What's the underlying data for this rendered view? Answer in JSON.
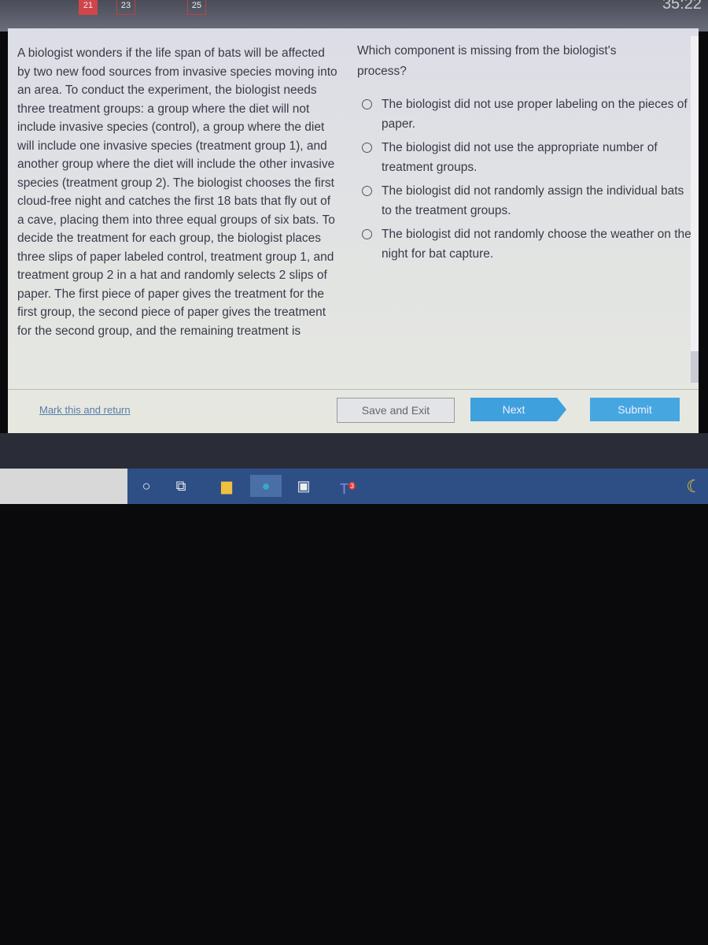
{
  "topbar": {
    "question_numbers": [
      "21",
      "23",
      "25"
    ],
    "timer": "35:22"
  },
  "passage": "A biologist wonders if the life span of bats will be affected by two new food sources from invasive species moving into an area. To conduct the experiment, the biologist needs three treatment groups: a group where the diet will not include invasive species (control), a group where the diet will include one invasive species (treatment group 1), and another group where the diet will include the other invasive species (treatment group 2). The biologist chooses the first cloud-free night and catches the first 18 bats that fly out of a cave, placing them into three equal groups of six bats. To decide the treatment for each group, the biologist places three slips of paper labeled control, treatment group 1, and treatment group 2 in a hat and randomly selects 2 slips of paper. The first piece of paper gives the treatment for the first group, the second piece of paper gives the treatment for the second group, and the remaining treatment is",
  "question": "Which component is missing from the biologist's process?",
  "options": [
    "The biologist did not use proper labeling on the pieces of paper.",
    "The biologist did not use the appropriate number of treatment groups.",
    "The biologist did not randomly assign the individual bats to the treatment groups.",
    "The biologist did not randomly choose the weather on the night for bat capture."
  ],
  "footer": {
    "mark": "Mark this and return",
    "save": "Save and Exit",
    "next": "Next",
    "submit": "Submit"
  },
  "taskbar": {
    "icons": [
      "cortana-icon",
      "task-view-icon",
      "file-explorer-icon",
      "edge-icon",
      "store-icon",
      "teams-icon"
    ],
    "teams_badge": "3"
  }
}
